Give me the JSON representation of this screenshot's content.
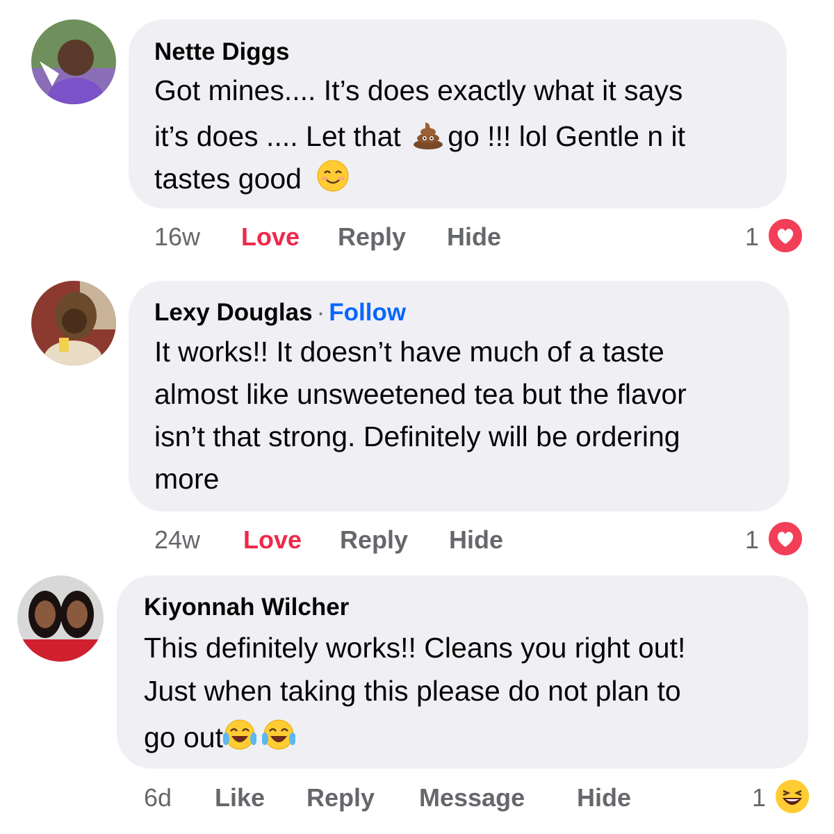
{
  "comments": [
    {
      "author": "Nette Diggs",
      "lines": [
        "Got mines.... It’s does exactly what it says",
        "it’s does .... Let that ",
        "go !!! lol Gentle n it",
        "tastes good"
      ],
      "emoji_inline": [
        "pile-of-poo-emoji",
        "smiling-face-emoji"
      ],
      "time": "16w",
      "actions": [
        "Love",
        "Reply",
        "Hide"
      ],
      "reaction_count": "1",
      "reaction": "heart"
    },
    {
      "author": "Lexy Douglas",
      "separator": "·",
      "follow": "Follow",
      "lines": [
        "It works!!  It doesn’t have much of a taste",
        "almost like unsweetened tea but the flavor",
        "isn’t that strong. Definitely will be ordering",
        "more"
      ],
      "time": "24w",
      "actions": [
        "Love",
        "Reply",
        "Hide"
      ],
      "reaction_count": "1",
      "reaction": "heart"
    },
    {
      "author": "Kiyonnah Wilcher",
      "lines": [
        "This definitely works!! Cleans you right out!",
        "Just when taking this please do not plan to",
        "go out"
      ],
      "emoji_inline": [
        "tears-of-joy-emoji",
        "tears-of-joy-emoji"
      ],
      "time": "6d",
      "actions": [
        "Like",
        "Reply",
        "Message",
        "Hide"
      ],
      "reaction_count": "1",
      "reaction": "haha"
    }
  ],
  "colors": {
    "bubble": "#f0f0f4",
    "love": "#f0284a",
    "follow": "#0866ff",
    "muted": "#65676b"
  }
}
